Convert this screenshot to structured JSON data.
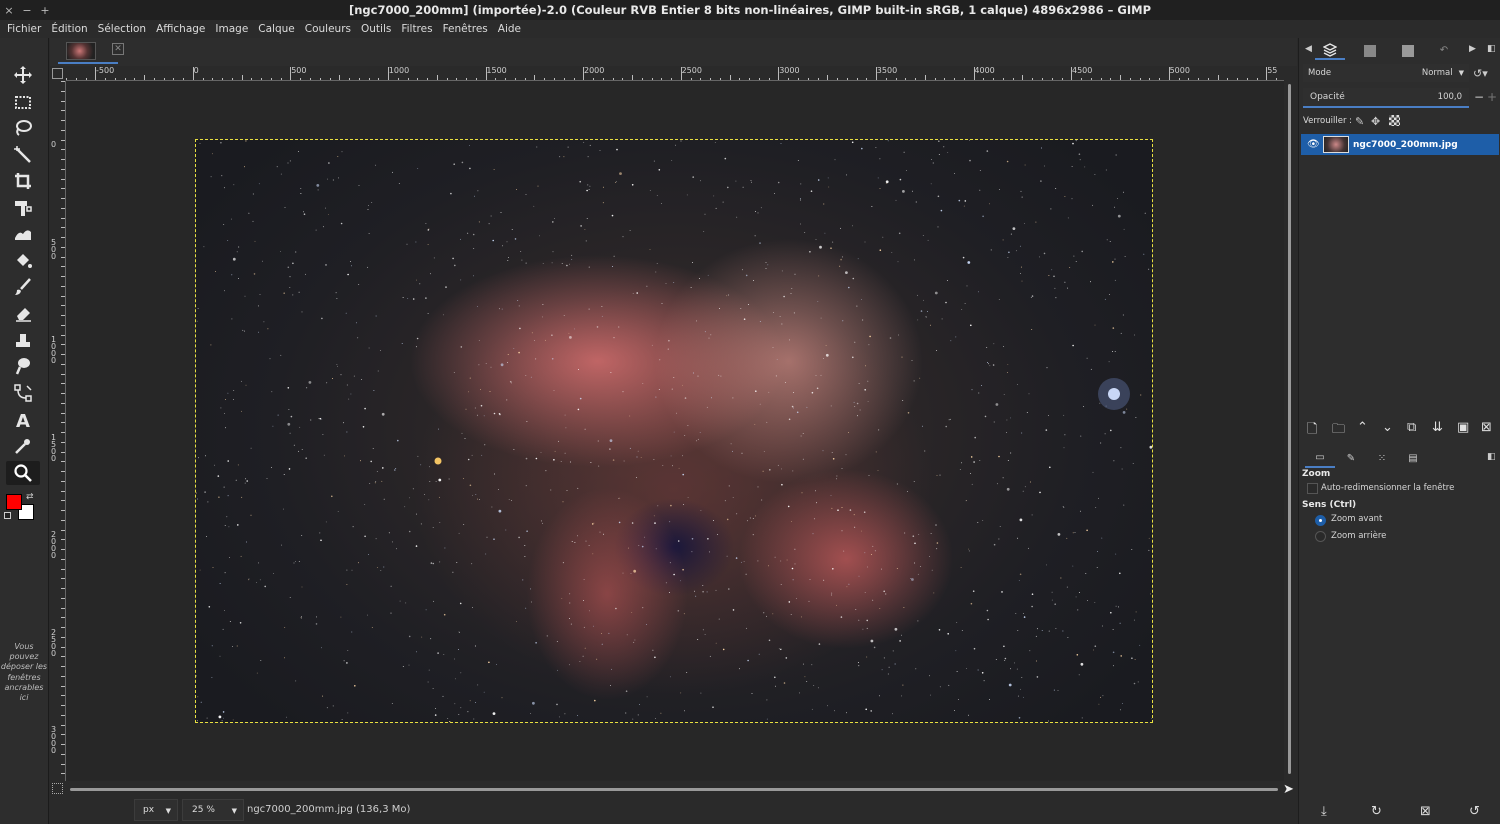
{
  "window": {
    "title": "[ngc7000_200mm] (importée)-2.0 (Couleur RVB Entier 8 bits non-linéaires, GIMP built-in sRGB, 1 calque) 4896x2986 – GIMP",
    "buttons": [
      "×",
      "−",
      "+"
    ]
  },
  "menu": [
    "Fichier",
    "Édition",
    "Sélection",
    "Affichage",
    "Image",
    "Calque",
    "Couleurs",
    "Outils",
    "Filtres",
    "Fenêtres",
    "Aide"
  ],
  "toolbox": {
    "tools": [
      "move-tool",
      "rect-select-tool",
      "free-select-tool",
      "fuzzy-select-tool",
      "crop-tool",
      "unified-transform-tool",
      "warp-transform-tool",
      "bucket-fill-tool",
      "paintbrush-tool",
      "eraser-tool",
      "clone-tool",
      "smudge-tool",
      "paths-tool",
      "text-tool",
      "color-picker-tool",
      "zoom-tool"
    ],
    "active": "zoom-tool",
    "fg_color": "#ff0000",
    "bg_color": "#ffffff",
    "dock_hint": "Vous pouvez déposer les fenêtres ancrables ici"
  },
  "ruler": {
    "h_labels": [
      "-500",
      "0",
      "500",
      "1000",
      "1500",
      "2000",
      "2500",
      "3000",
      "3500",
      "4000",
      "4500",
      "5000",
      "55"
    ],
    "v_labels": [
      "0",
      "500",
      "1000",
      "1500",
      "2000",
      "2500",
      "3000"
    ]
  },
  "status": {
    "unit": "px",
    "zoom": "25 %",
    "info": "ngc7000_200mm.jpg (136,3 Mo)"
  },
  "layers": {
    "mode_label": "Mode",
    "mode_value": "Normal",
    "opacity_label": "Opacité",
    "opacity_value": "100,0",
    "lock_label": "Verrouiller :",
    "items": [
      {
        "name": "ngc7000_200mm.jpg",
        "visible": true,
        "selected": true
      }
    ]
  },
  "tool_options": {
    "title": "Zoom",
    "auto_resize_label": "Auto-redimensionner la fenêtre",
    "auto_resize": false,
    "direction_label": "Sens (Ctrl)",
    "options": [
      {
        "label": "Zoom avant",
        "selected": true
      },
      {
        "label": "Zoom arrière",
        "selected": false
      }
    ]
  },
  "colors": {
    "accent": "#1e5ea8",
    "selection": "#e8e040"
  }
}
